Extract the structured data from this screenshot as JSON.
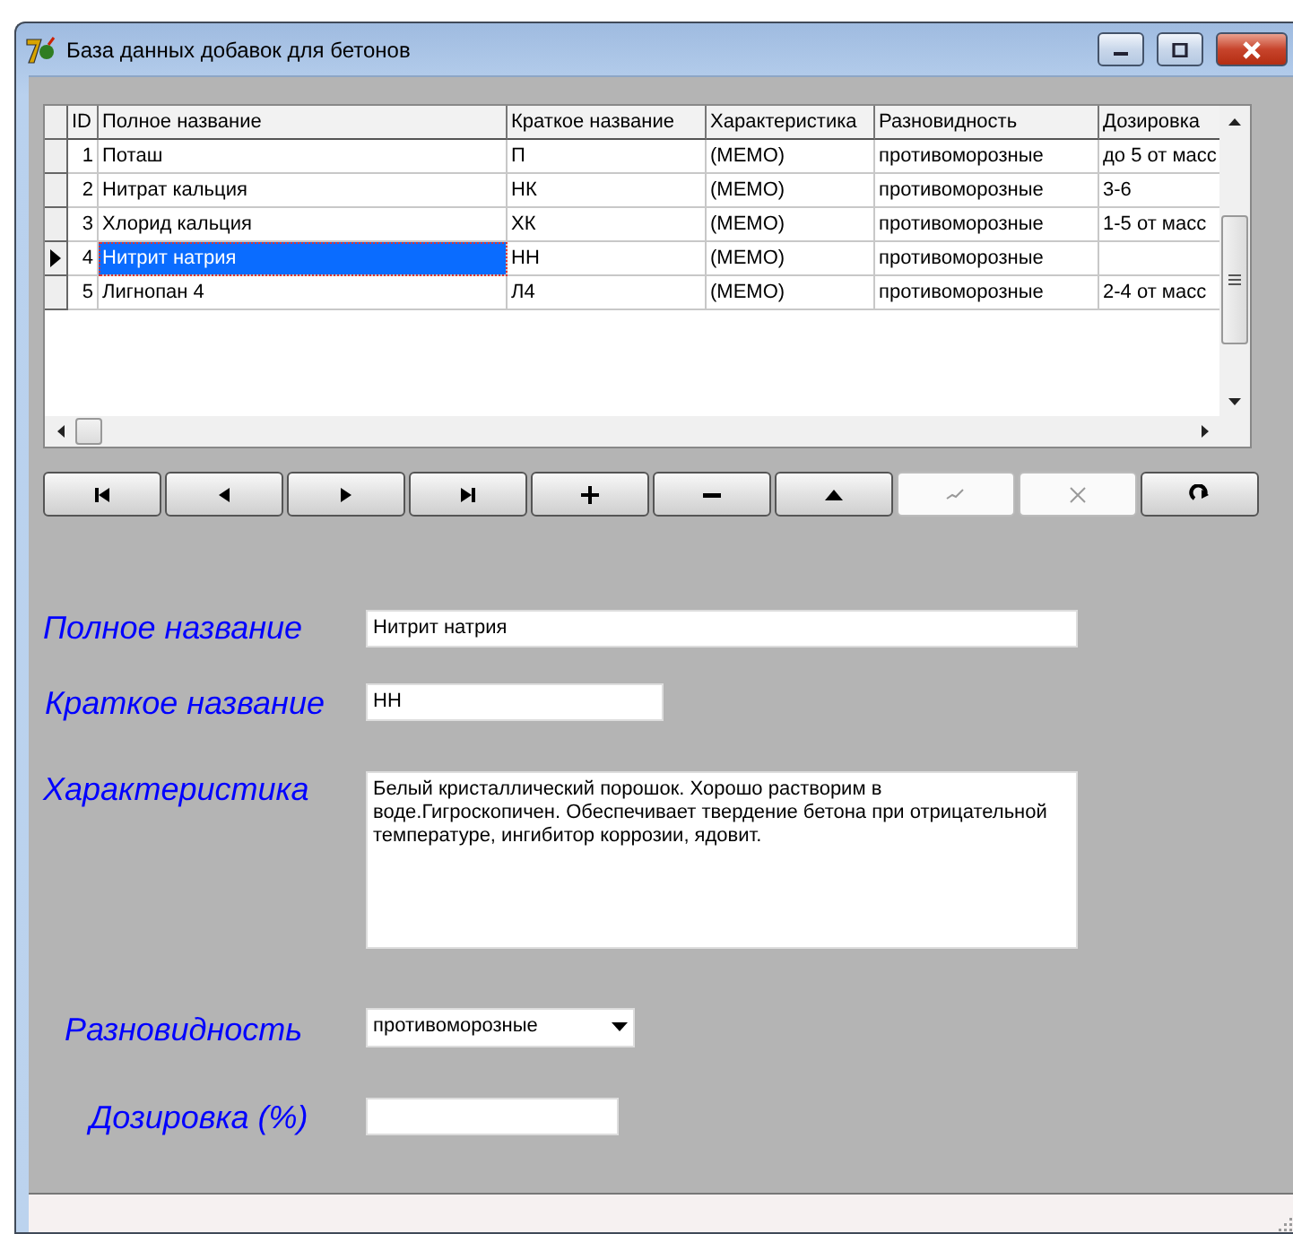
{
  "window": {
    "title": "База данных добавок для бетонов"
  },
  "grid": {
    "columns": [
      "ID",
      "Полное название",
      "Краткое название",
      "Характеристика",
      "Разновидность",
      "Дозировка"
    ],
    "rows": [
      {
        "selected": false,
        "cells": [
          "1",
          "Поташ",
          "П",
          "(MEMO)",
          "противоморозные",
          "до 5 от масс"
        ]
      },
      {
        "selected": false,
        "cells": [
          "2",
          "Нитрат кальция",
          "НК",
          "(MEMO)",
          "противоморозные",
          "3-6"
        ]
      },
      {
        "selected": false,
        "cells": [
          "3",
          "Хлорид кальция",
          "ХК",
          "(MEMO)",
          "противоморозные",
          "1-5 от масс"
        ]
      },
      {
        "selected": true,
        "cells": [
          "4",
          "Нитрит натрия",
          "НН",
          "(MEMO)",
          "противоморозные",
          ""
        ]
      },
      {
        "selected": false,
        "cells": [
          "5",
          "Лигнопан 4",
          "Л4",
          "(MEMO)",
          "противоморозные",
          "2-4 от масс"
        ]
      }
    ]
  },
  "navigator": [
    {
      "kind": "first",
      "disabled": false
    },
    {
      "kind": "prior",
      "disabled": false
    },
    {
      "kind": "next",
      "disabled": false
    },
    {
      "kind": "last",
      "disabled": false
    },
    {
      "kind": "insert",
      "disabled": false
    },
    {
      "kind": "delete",
      "disabled": false
    },
    {
      "kind": "edit",
      "disabled": false
    },
    {
      "kind": "post",
      "disabled": true
    },
    {
      "kind": "cancel",
      "disabled": true
    },
    {
      "kind": "refresh",
      "disabled": false
    }
  ],
  "form": [
    {
      "kind": "text",
      "label": "Полное название",
      "value": "Нитрит натрия"
    },
    {
      "kind": "short",
      "label": "Краткое название",
      "value": "НН"
    },
    {
      "kind": "memo",
      "label": "Характеристика",
      "value": "Белый кристаллический порошок. Хорошо растворим в воде.Гигроскопичен. Обеспечивает твердение бетона при отрицательной температуре, ингибитор коррозии, ядовит."
    },
    {
      "kind": "combo",
      "label": "Разновидность",
      "value": "противоморозные"
    },
    {
      "kind": "number",
      "label": "Дозировка (%)"
    }
  ]
}
